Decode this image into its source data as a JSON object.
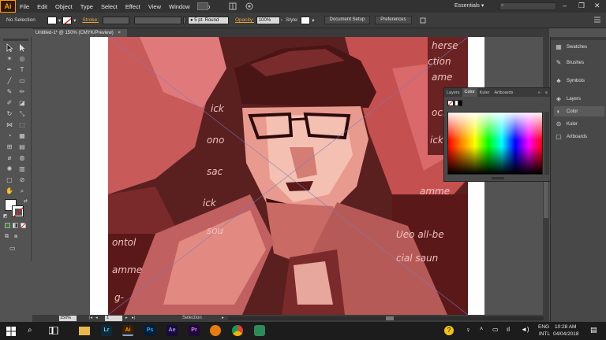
{
  "app": {
    "logo": "Ai",
    "workspace": "Essentials",
    "search_placeholder": ""
  },
  "menu": [
    "File",
    "Edit",
    "Object",
    "Type",
    "Select",
    "Effect",
    "View",
    "Window",
    "Help"
  ],
  "control_bar": {
    "selection_label": "No Selection",
    "stroke_label": "Stroke:",
    "brush_value": "5 pt. Round",
    "opacity_label": "Opacity:",
    "opacity_value": "100%",
    "style_label": "Style:",
    "document_setup_label": "Document Setup",
    "preferences_label": "Preferences"
  },
  "document": {
    "tab_label": "Untitled-1* @ 150% (CMYK/Preview)",
    "tab_close": "×"
  },
  "status_bar": {
    "zoom": "150%",
    "page": "1",
    "tool": "Selection"
  },
  "dock": {
    "items": [
      {
        "label": "Swatches",
        "icon": "swatches-icon"
      },
      {
        "label": "Brushes",
        "icon": "brushes-icon"
      },
      {
        "label": "Symbols",
        "icon": "symbols-icon"
      },
      {
        "label": "Layers",
        "icon": "layers-icon"
      },
      {
        "label": "Color",
        "icon": "color-icon"
      },
      {
        "label": "Kuler",
        "icon": "kuler-icon"
      },
      {
        "label": "Artboards",
        "icon": "artboards-icon"
      }
    ]
  },
  "color_panel": {
    "tabs": [
      "Layers",
      "Color",
      "Kuler",
      "Artboards"
    ],
    "active_tab": "Color"
  },
  "artwork": {
    "texts": [
      "herse",
      "ction",
      "ame",
      "ick",
      "ono",
      "ock",
      "ick",
      "sac",
      "amme",
      "ick",
      "sou",
      "ontol",
      "Ueo all-be",
      "cial saun",
      "amme",
      "g-"
    ]
  },
  "taskbar": {
    "apps": [
      {
        "name": "Lr",
        "color": "#0c2a3a",
        "fg": "#7ec3f5"
      },
      {
        "name": "Ai",
        "color": "#3a1e04",
        "fg": "#ff9a00"
      },
      {
        "name": "Ps",
        "color": "#001e36",
        "fg": "#31a8ff"
      },
      {
        "name": "Ae",
        "color": "#1a0a3a",
        "fg": "#9999ff"
      },
      {
        "name": "Pr",
        "color": "#1e0a3a",
        "fg": "#ea77ff"
      }
    ],
    "lang": "ENG",
    "layout": "INTL",
    "time": "10:28 AM",
    "date": "04/04/2018"
  }
}
